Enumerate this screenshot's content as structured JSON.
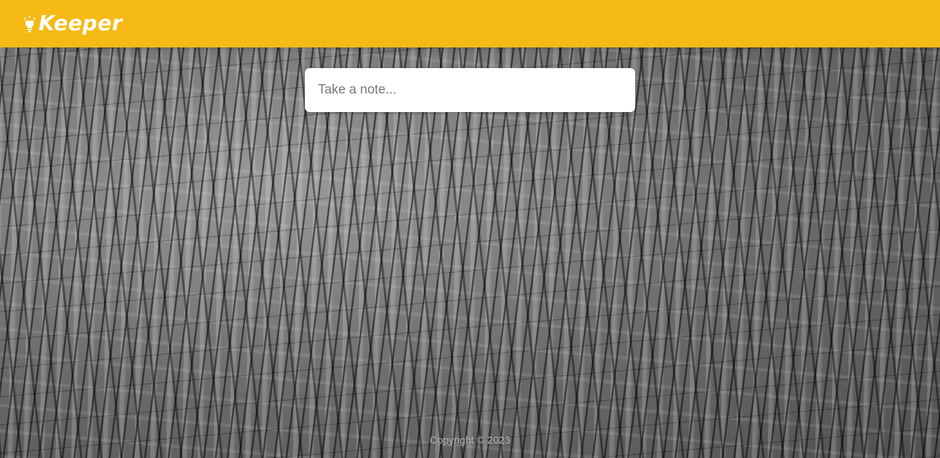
{
  "header": {
    "logo_icon": "lightbulb-icon",
    "title": "Keeper",
    "background_color": "#f5ba13"
  },
  "note_form": {
    "placeholder": "Take a note..."
  },
  "footer": {
    "copyright": "Copyright © 2023"
  },
  "background": {
    "texture": "tree-bark"
  }
}
